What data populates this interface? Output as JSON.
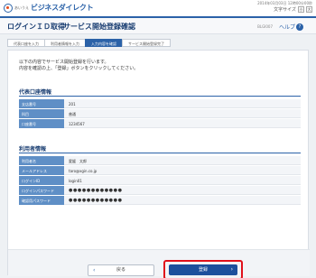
{
  "brand": {
    "name": "ビジネスダイレクト",
    "sub": "あいうえ"
  },
  "topbar": {
    "datetime": "2014年03月03日 12時00分00秒",
    "text_size_label": "文字サイズ",
    "text_size_small": "小",
    "text_size_large": "大"
  },
  "header": {
    "title_main": "ログインＩＤ取得",
    "title_sub": "サービス開始登録確認",
    "screen_id": "BLGI007",
    "help_label": "ヘルプ",
    "help_icon": "?"
  },
  "steps": [
    {
      "label": "代表口座を入力",
      "active": false
    },
    {
      "label": "利用者情報を入力",
      "active": false
    },
    {
      "label": "入力内容を確認",
      "active": true
    },
    {
      "label": "サービス開始登録完了",
      "active": false
    }
  ],
  "intro": {
    "line1": "以下の内容でサービス開始登録を行います。",
    "line2": "内容を確認の上、「登録」ボタンをクリックしてください。"
  },
  "account_section": {
    "title": "代表口座情報",
    "rows": [
      {
        "label": "支店番号",
        "value": "201"
      },
      {
        "label": "科目",
        "value": "普通"
      },
      {
        "label": "口座番号",
        "value": "1234567"
      }
    ]
  },
  "user_section": {
    "title": "利用者情報",
    "rows": [
      {
        "label": "利用者名",
        "value": "愛媛　太郎"
      },
      {
        "label": "メールアドレス",
        "value": "taro@xgin.co.jp"
      },
      {
        "label": "ログインID",
        "value": "login01"
      },
      {
        "label": "ログインパスワード",
        "value": "●●●●●●●●●●●●"
      },
      {
        "label": "確認用パスワード",
        "value": "●●●●●●●●●●●●"
      }
    ]
  },
  "buttons": {
    "back_label": "戻る",
    "back_icon": "‹",
    "submit_label": "登録",
    "submit_icon": "›"
  }
}
